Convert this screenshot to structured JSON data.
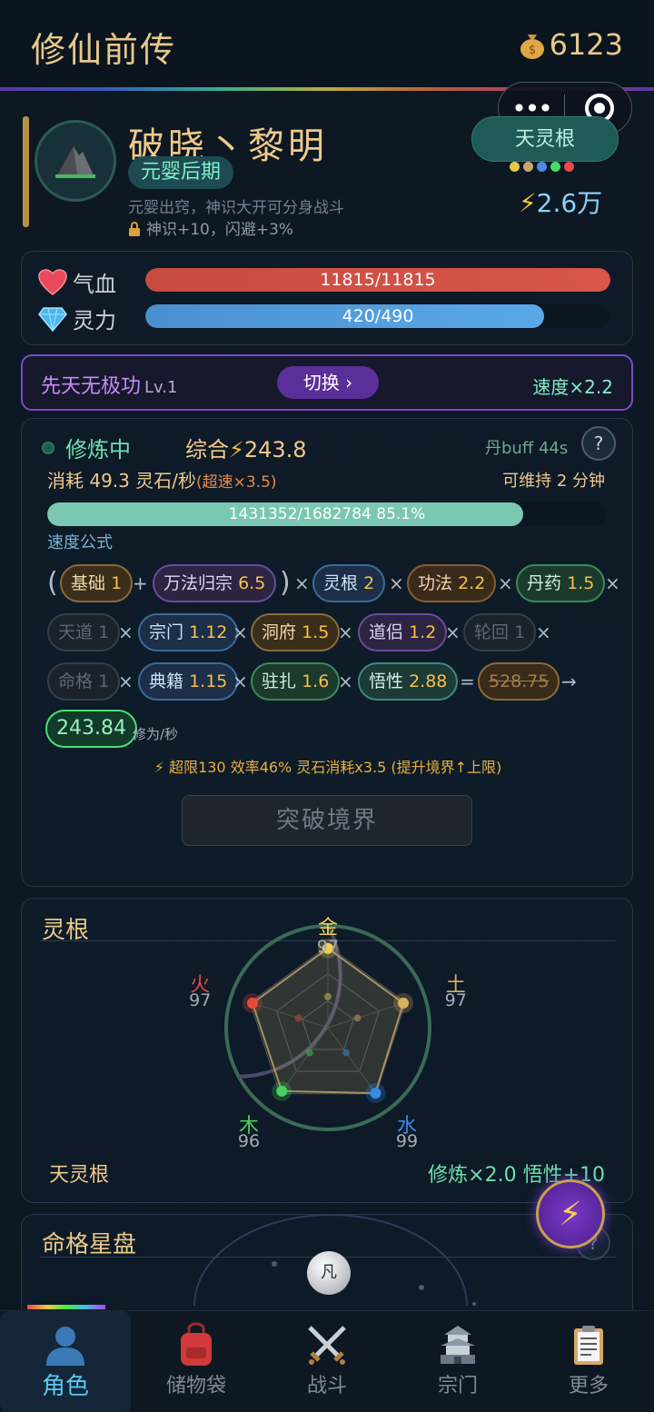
{
  "header": {
    "title": "修仙前传",
    "coins": "6123",
    "coin_icon": "money-bag-icon"
  },
  "profile": {
    "name": "破晓丶黎明",
    "realm": "元婴后期",
    "description": "元婴出窍，神识大开可分身战斗",
    "bonus": "神识+10，闪避+3%",
    "spirit_root": "天灵根",
    "root_dot_colors": [
      "#e8c84a",
      "#c8a86a",
      "#4a8ae8",
      "#4ad868",
      "#e84a4a"
    ],
    "power_icon": "⚡",
    "power": "2.6万"
  },
  "vitals": {
    "hp_label": "气血",
    "hp_text": "11815/11815",
    "hp_ratio": 1.0,
    "mp_label": "灵力",
    "mp_text": "420/490",
    "mp_ratio": 0.857
  },
  "technique": {
    "name": "先天无极功",
    "level": "Lv.1",
    "switch_label": "切换 ›",
    "speed": "速度×2.2"
  },
  "cultivation": {
    "status": "修炼中",
    "total_label": "综合",
    "total_value": "243.8",
    "buff": "丹buff 44s",
    "cost_label": "消耗 49.3 灵石/秒",
    "cost_note": "(超速×3.5)",
    "sustain": "可维持 2 分钟",
    "progress_text": "1431352/1682784  85.1%",
    "progress_ratio": 0.851,
    "formula_label": "速度公式",
    "chips": {
      "base_n": "基础",
      "base_v": "1",
      "wanfa_n": "万法归宗",
      "wanfa_v": "6.5",
      "root_n": "灵根",
      "root_v": "2",
      "gongfa_n": "功法",
      "gongfa_v": "2.2",
      "dan_n": "丹药",
      "dan_v": "1.5",
      "tiandao_n": "天道",
      "tiandao_v": "1",
      "zongmen_n": "宗门",
      "zongmen_v": "1.12",
      "dongfu_n": "洞府",
      "dongfu_v": "1.5",
      "daolv_n": "道侣",
      "daolv_v": "1.2",
      "lunhui_n": "轮回",
      "lunhui_v": "1",
      "mingge_n": "命格",
      "mingge_v": "1",
      "dianji_n": "典籍",
      "dianji_v": "1.15",
      "zhuzha_n": "驻扎",
      "zhuzha_v": "1.6",
      "wuxing_n": "悟性",
      "wuxing_v": "2.88",
      "raw": "528.75",
      "result": "243.84"
    },
    "unit": "修为/秒",
    "warning": "⚡ 超限130 效率46% 灵石消耗x3.5 (提升境界↑上限)",
    "breakthrough_label": "突破境界"
  },
  "roots": {
    "section_title": "灵根",
    "elements": [
      {
        "name": "金",
        "value": 97,
        "color": "#f0d050"
      },
      {
        "name": "土",
        "value": 97,
        "color": "#d8b060"
      },
      {
        "name": "水",
        "value": 99,
        "color": "#3a8ae8"
      },
      {
        "name": "木",
        "value": 96,
        "color": "#4ad060"
      },
      {
        "name": "火",
        "value": 97,
        "color": "#e84a3a"
      }
    ],
    "root_name": "天灵根",
    "root_bonus": "修炼×2.0  悟性+10"
  },
  "destiny": {
    "section_title": "命格星盘",
    "orb_label": "凡"
  },
  "tabs": [
    {
      "label": "角色",
      "icon": "character-icon"
    },
    {
      "label": "储物袋",
      "icon": "backpack-icon"
    },
    {
      "label": "战斗",
      "icon": "crossed-swords-icon"
    },
    {
      "label": "宗门",
      "icon": "pagoda-icon"
    },
    {
      "label": "更多",
      "icon": "clipboard-icon"
    }
  ]
}
